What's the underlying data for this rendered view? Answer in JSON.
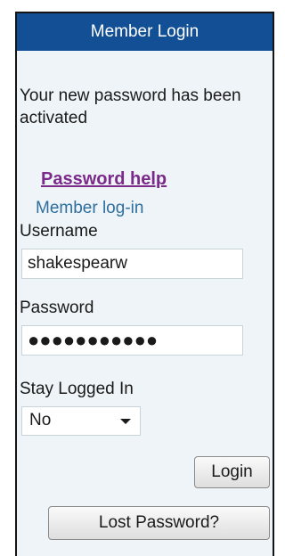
{
  "header": {
    "title": "Member Login"
  },
  "message": {
    "text": "Your new password has been activated"
  },
  "links": {
    "password_help": "Password help",
    "member_login": "Member log-in"
  },
  "form": {
    "username_label": "Username",
    "username_value": "shakespearw",
    "password_label": "Password",
    "password_masked": "●●●●●●●●●●●",
    "stay_logged_in_label": "Stay Logged In",
    "stay_logged_in_selected": "No"
  },
  "buttons": {
    "login_label": "Login",
    "lost_password_label": "Lost Password?"
  },
  "colors": {
    "header_bg": "#134f94",
    "panel_bg": "#eef4f7",
    "link_help": "#7b2a8a",
    "link_member": "#2f6f9f"
  }
}
